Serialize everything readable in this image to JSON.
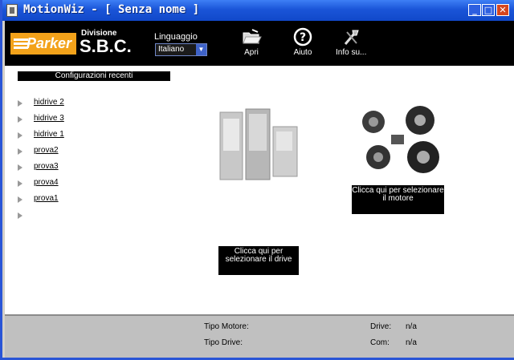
{
  "window": {
    "title": "MotionWiz - [ Senza nome ]",
    "min": "_",
    "max": "□",
    "close": "✕"
  },
  "header": {
    "brand": "Parker",
    "division_label": "Divisione",
    "division_name": "S.B.C.",
    "language_label": "Linguaggio",
    "language_value": "Italiano",
    "buttons": {
      "open": "Apri",
      "help": "Aiuto",
      "info": "Info su..."
    }
  },
  "recent": {
    "title": "Configurazioni recenti",
    "items": [
      "hidrive 2",
      "hidrive 3",
      "hidrive 1",
      "prova2",
      "prova3",
      "prova4",
      "prova1",
      ""
    ]
  },
  "drive": {
    "caption": "Clicca qui per selezionare il drive"
  },
  "motor": {
    "caption": "Clicca qui per selezionare il motore"
  },
  "status": {
    "motor_type_label": "Tipo Motore:",
    "drive_type_label": "Tipo Drive:",
    "drive_label": "Drive:",
    "drive_value": "n/a",
    "com_label": "Com:",
    "com_value": "n/a"
  },
  "icons": {
    "open": "folder-open-icon",
    "help": "help-icon",
    "info": "tools-icon"
  }
}
